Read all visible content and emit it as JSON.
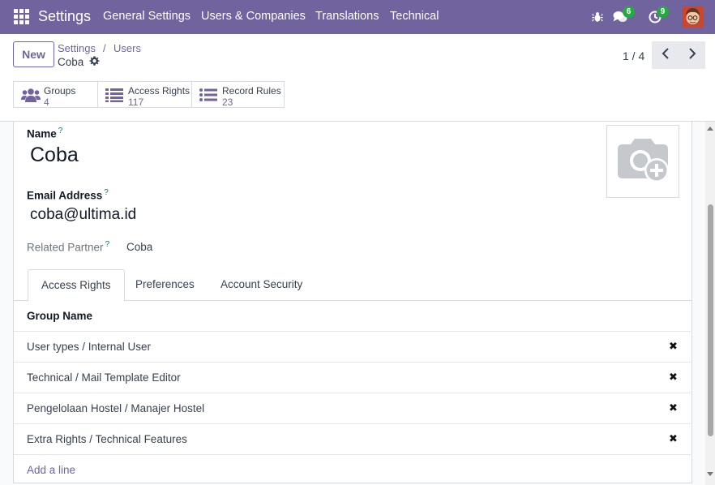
{
  "navbar": {
    "brand": "Settings",
    "menu": [
      "General Settings",
      "Users & Companies",
      "Translations",
      "Technical"
    ],
    "messages_count": "6",
    "activities_count": "9",
    "colors": {
      "background": "#71639e",
      "badge": "#28a745"
    }
  },
  "control": {
    "new_label": "New",
    "breadcrumb": [
      "Settings",
      "Users"
    ],
    "breadcrumb_separator": "/",
    "record_name": "Coba",
    "pager": "1 / 4"
  },
  "stats": [
    {
      "label": "Groups",
      "value": "4",
      "icon": "users-icon"
    },
    {
      "label": "Access Rights",
      "value": "117",
      "icon": "list-icon"
    },
    {
      "label": "Record Rules",
      "value": "23",
      "icon": "list-ul-icon"
    }
  ],
  "form": {
    "name_label": "Name",
    "name_value": "Coba",
    "email_label": "Email Address",
    "email_value": "coba@ultima.id",
    "partner_label": "Related Partner",
    "partner_value": "Coba",
    "help_mark": "?"
  },
  "tabs": [
    {
      "label": "Access Rights",
      "active": true
    },
    {
      "label": "Preferences",
      "active": false
    },
    {
      "label": "Account Security",
      "active": false
    }
  ],
  "groups_table": {
    "header": "Group Name",
    "rows": [
      "User types / Internal User",
      "Technical / Mail Template Editor",
      "Pengelolaan Hostel / Manajer Hostel",
      "Extra Rights / Technical Features"
    ],
    "remove_symbol": "✖",
    "add_line": "Add a line"
  }
}
